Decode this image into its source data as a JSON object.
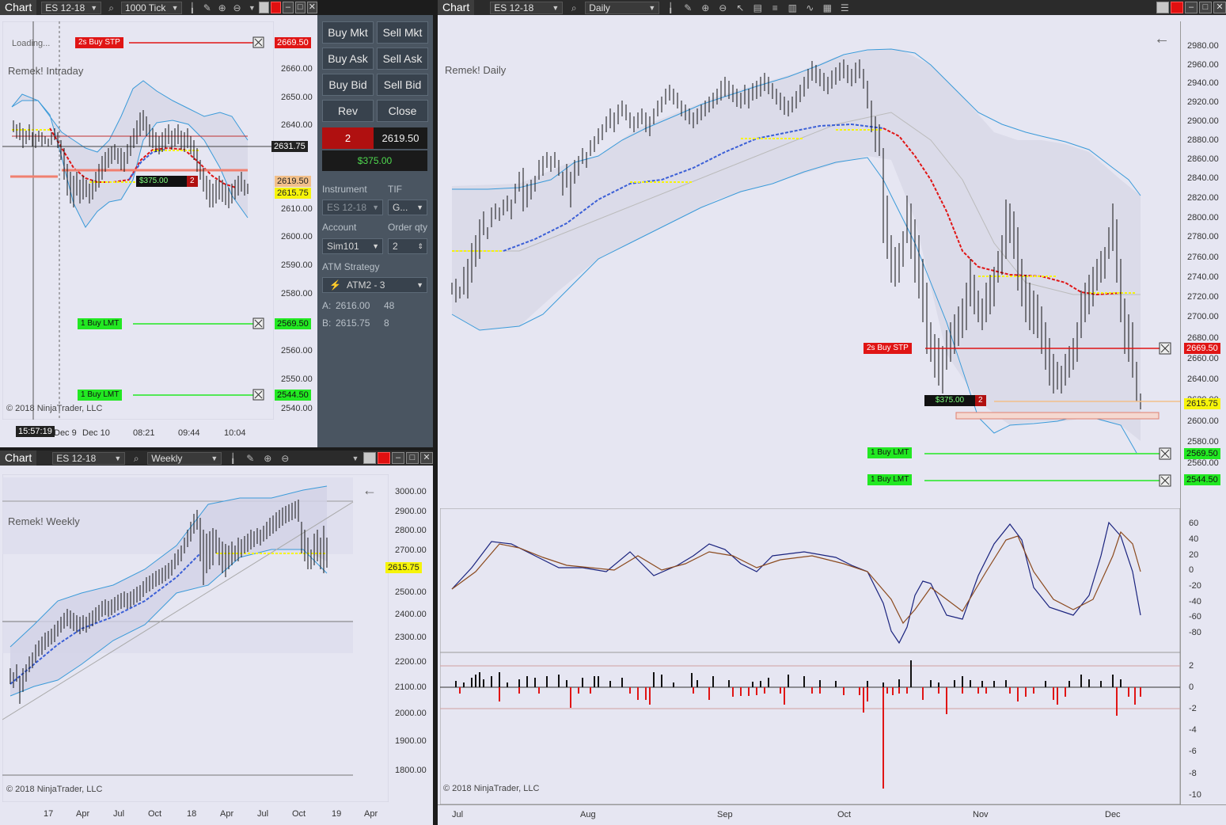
{
  "colors": {
    "buy_stp": "#e01515",
    "buy_lmt": "#22e822",
    "last_price": "#f6f40a",
    "bid_ask": "#f2c08a",
    "panel_bg": "#4a5561",
    "chart_bg": "#e6e6f2",
    "band_fill": "#d6d6e6",
    "band_line": "#3a9ad9",
    "ema_red": "#e01515",
    "ema_blue": "#3b5fd6"
  },
  "intraday": {
    "toolbar": {
      "chart_label": "Chart",
      "instrument": "ES 12-18",
      "period": "1000 Tick"
    },
    "status": "Loading...",
    "title": "Remek! Intraday",
    "copyright": "© 2018 NinjaTrader, LLC",
    "price_labels": [
      "2660.00",
      "2650.00",
      "2640.00",
      "2620.00",
      "2610.00",
      "2600.00",
      "2590.00",
      "2580.00",
      "2560.00",
      "2550.00",
      "2540.00"
    ],
    "time_labels": [
      "Dec 9",
      "Dec 10",
      "08:21",
      "09:44",
      "10:04"
    ],
    "cursor_time": "15:57:19",
    "crosshair_price": "2631.75",
    "buy_stp": {
      "label": "2s  Buy STP",
      "price": "2669.50"
    },
    "buy_lmt_1": {
      "label": "1  Buy LMT",
      "price": "2569.50"
    },
    "buy_lmt_2": {
      "label": "1  Buy LMT",
      "price": "2544.50"
    },
    "ask_price": "2619.50",
    "last_price": "2615.75",
    "position_pnl": "$375.00",
    "position_qty": "2"
  },
  "panel": {
    "buttons": [
      "Buy Mkt",
      "Sell Mkt",
      "Buy Ask",
      "Sell Ask",
      "Buy Bid",
      "Sell Bid",
      "Rev",
      "Close"
    ],
    "position_qty": "2",
    "position_price": "2619.50",
    "unrealized": "$375.00",
    "instrument_label": "Instrument",
    "tif_label": "TIF",
    "instrument_value": "ES 12-18",
    "tif_value": "G...",
    "account_label": "Account",
    "order_qty_label": "Order qty",
    "account_value": "Sim101",
    "order_qty_value": "2",
    "atm_label": "ATM Strategy",
    "atm_value": "ATM2 - 3",
    "ask_line_label": "A:",
    "ask_line_price": "2616.00",
    "ask_line_size": "48",
    "bid_line_label": "B:",
    "bid_line_price": "2615.75",
    "bid_line_size": "8"
  },
  "weekly": {
    "toolbar": {
      "chart_label": "Chart",
      "instrument": "ES 12-18",
      "period": "Weekly"
    },
    "title": "Remek! Weekly",
    "copyright": "© 2018 NinjaTrader, LLC",
    "price_labels": [
      "3000.00",
      "2900.00",
      "2800.00",
      "2700.00",
      "2500.00",
      "2400.00",
      "2300.00",
      "2200.00",
      "2100.00",
      "2000.00",
      "1900.00",
      "1800.00"
    ],
    "time_labels": [
      "17",
      "Apr",
      "Jul",
      "Oct",
      "18",
      "Apr",
      "Jul",
      "Oct",
      "19",
      "Apr"
    ],
    "last_price": "2615.75"
  },
  "daily": {
    "toolbar": {
      "chart_label": "Chart",
      "instrument": "ES 12-18",
      "period": "Daily"
    },
    "title": "Remek! Daily",
    "copyright": "© 2018 NinjaTrader, LLC",
    "price_labels": [
      "2980.00",
      "2960.00",
      "2940.00",
      "2920.00",
      "2900.00",
      "2880.00",
      "2860.00",
      "2840.00",
      "2820.00",
      "2800.00",
      "2780.00",
      "2760.00",
      "2740.00",
      "2720.00",
      "2700.00",
      "2680.00",
      "2660.00",
      "2640.00",
      "2620.00",
      "2600.00",
      "2580.00",
      "2560.00"
    ],
    "osc_labels": [
      "60",
      "40",
      "20",
      "0",
      "-20",
      "-40",
      "-60",
      "-80"
    ],
    "hist_labels": [
      "2",
      "0",
      "-2",
      "-4",
      "-6",
      "-8",
      "-10"
    ],
    "time_labels": [
      "Jul",
      "Aug",
      "Sep",
      "Oct",
      "Nov",
      "Dec"
    ],
    "buy_stp": {
      "label": "2s  Buy STP",
      "price": "2669.50"
    },
    "buy_lmt_1": {
      "label": "1  Buy LMT",
      "price": "2569.50"
    },
    "buy_lmt_2": {
      "label": "1  Buy LMT",
      "price": "2544.50"
    },
    "last_price": "2615.75",
    "position_pnl": "$375.00",
    "position_qty": "2"
  }
}
